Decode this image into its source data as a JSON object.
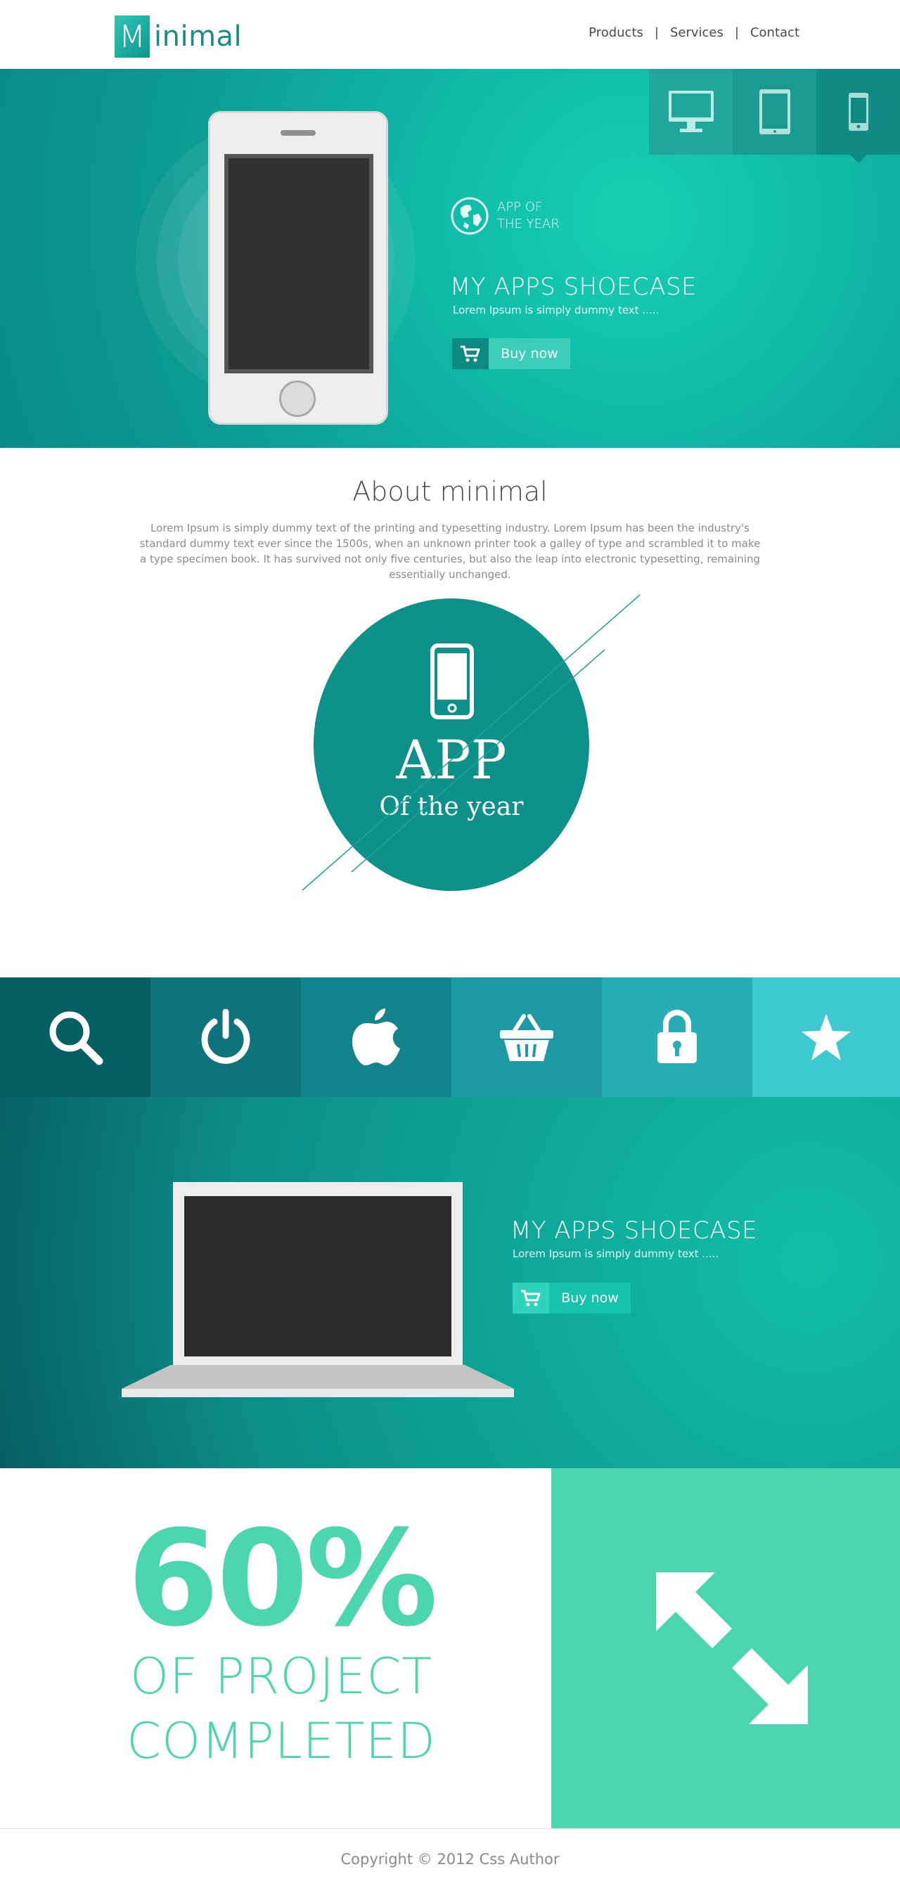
{
  "header": {
    "logo_letter": "M",
    "logo_text": "inimal",
    "nav": [
      "Products",
      "Services",
      "Contact"
    ],
    "nav_separator": "|"
  },
  "hero": {
    "device_tabs": [
      "desktop-icon",
      "tablet-icon",
      "mobile-icon"
    ],
    "active_tab": "mobile-icon",
    "award_line1": "APP OF",
    "award_line2": "THE YEAR",
    "title": "MY APPS SHOECASE",
    "subtitle": "Lorem Ipsum is simply dummy text .....",
    "buy_label": "Buy now"
  },
  "about": {
    "title": "About minimal",
    "text": "Lorem Ipsum is simply dummy text of the printing and typesetting industry. Lorem Ipsum has been the industry's standard dummy text ever since the 1500s, when an unknown printer took a galley of type and scrambled it to make a type specimen book. It has survived not only five centuries, but also the leap into electronic typesetting, remaining essentially unchanged.",
    "badge_title": "APP",
    "badge_subtitle": "Of the year"
  },
  "icon_strip": {
    "icons": [
      "search-icon",
      "power-icon",
      "apple-icon",
      "basket-icon",
      "lock-icon",
      "star-icon"
    ],
    "colors": [
      "#065f63",
      "#0e737a",
      "#13848c",
      "#1e9aa4",
      "#28adb6",
      "#3ec8d0"
    ]
  },
  "laptop_section": {
    "title": "MY APPS SHOECASE",
    "subtitle": "Lorem Ipsum is simply dummy text .....",
    "buy_label": "Buy now"
  },
  "progress": {
    "value": "60%",
    "label_line1": "OF PROJECT",
    "label_line2": "COMPLETED"
  },
  "footer": {
    "copyright": "Copyright © 2012 Css Author"
  },
  "colors": {
    "teal_dark": "#0a8b87",
    "teal_light": "#17d0b3",
    "mint": "#4cd6ad",
    "text_gray": "#8c8c8c"
  }
}
